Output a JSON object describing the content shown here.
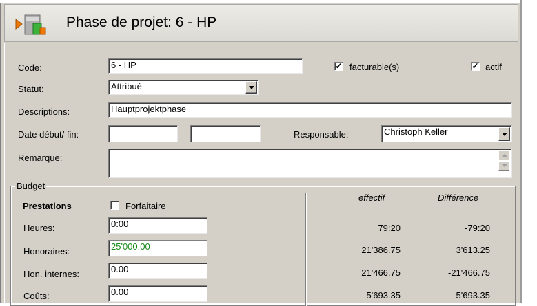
{
  "header": {
    "title": "Phase de projet: 6 - HP",
    "icon": "project-phase-icon"
  },
  "form": {
    "code_label": "Code:",
    "code_value": "6 - HP",
    "facturable_label": "facturable(s)",
    "facturable_checked": "✓",
    "actif_label": "actif",
    "actif_checked": "✓",
    "statut_label": "Statut:",
    "statut_value": "Attribué",
    "descriptions_label": "Descriptions:",
    "descriptions_value": "Hauptprojektphase",
    "date_label": "Date début/ fin:",
    "date_debut_value": "",
    "date_fin_value": "",
    "responsable_label": "Responsable:",
    "responsable_value": "Christoph Keller",
    "remarque_label": "Remarque:",
    "remarque_value": ""
  },
  "budget": {
    "group_label": "Budget",
    "prestations_label": "Prestations",
    "forfaitaire_label": "Forfaitaire",
    "col_effectif": "effectif",
    "col_difference": "Différence",
    "rows": [
      {
        "label": "Heures:",
        "value": "0:00",
        "effectif": "79:20",
        "difference": "-79:20"
      },
      {
        "label": "Honoraires:",
        "value": "25'000.00",
        "effectif": "21'386.75",
        "difference": "3'613.25"
      },
      {
        "label": "Hon. internes:",
        "value": "0.00",
        "effectif": "21'466.75",
        "difference": "-21'466.75"
      },
      {
        "label": "Coûts:",
        "value": "0.00",
        "effectif": "5'693.35",
        "difference": "-5'693.35"
      }
    ]
  },
  "colors": {
    "honoraires_value": "#1a8a1a",
    "icon_arrow": "#f07800",
    "icon_bar": "#3cb43c"
  }
}
